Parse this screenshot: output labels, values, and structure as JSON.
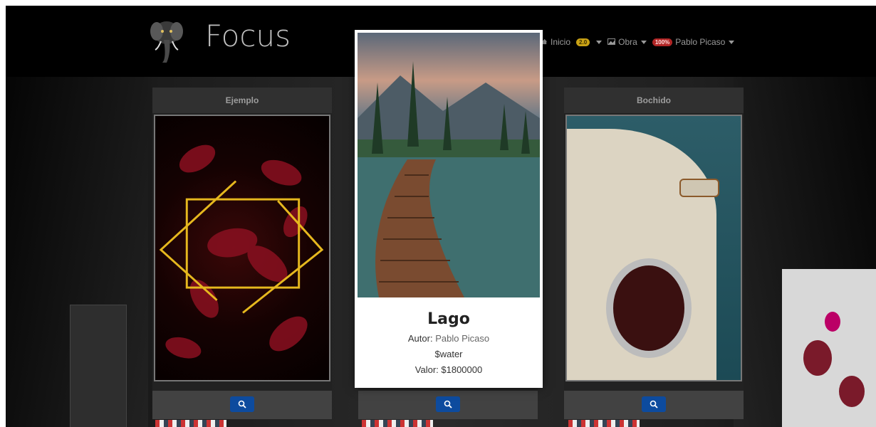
{
  "brand": {
    "name": "Focus",
    "logo_icon": "elephant-logo-icon"
  },
  "nav": {
    "inicio": "Inicio",
    "version_badge": "2.0",
    "obra": "Obra",
    "progress_badge": "100%",
    "user": "Pablo Picaso"
  },
  "cards": [
    {
      "title": "Ejemplo",
      "image": "neon-leaves-image"
    },
    {
      "title": "Bochido",
      "image": "beetle-car-image"
    }
  ],
  "modal": {
    "title": "Lago",
    "author_label": "Autor:",
    "author": "Pablo Picaso",
    "tag": "$water",
    "value": "Valor: $1800000",
    "image": "lake-boardwalk-image"
  },
  "colors": {
    "accent_button": "#0d4b9e",
    "badge_yellow": "#c9a215",
    "badge_red": "#b02525"
  }
}
